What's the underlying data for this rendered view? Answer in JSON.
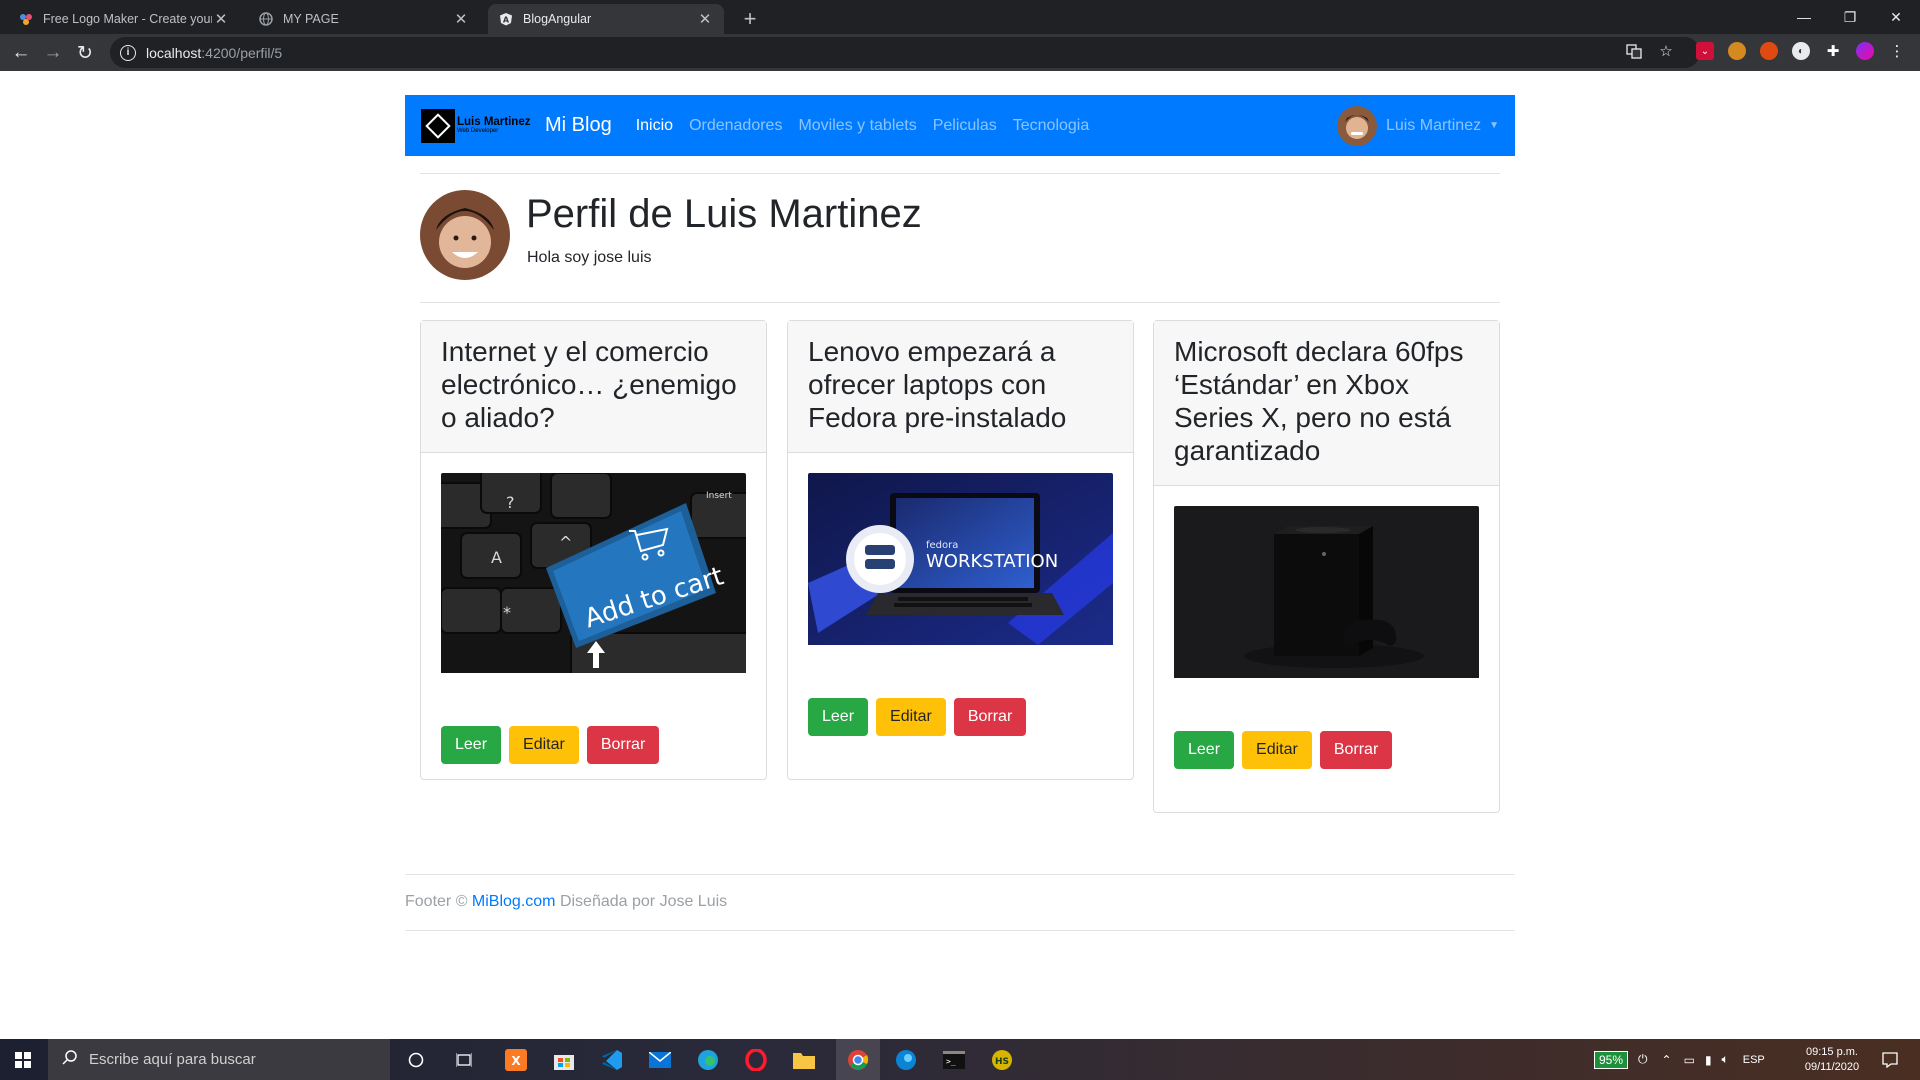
{
  "browser": {
    "tabs": [
      {
        "title": "Free Logo Maker - Create your o",
        "icon": "logo-maker-icon"
      },
      {
        "title": "MY PAGE",
        "icon": "globe-icon"
      },
      {
        "title": "BlogAngular",
        "icon": "angular-icon"
      }
    ],
    "url_host": "localhost",
    "url_path": ":4200/perfil/5"
  },
  "navbar": {
    "logo_name": "Luis Martinez",
    "logo_sub": "Web Developer",
    "brand": "Mi Blog",
    "links": [
      "Inicio",
      "Ordenadores",
      "Moviles y tablets",
      "Peliculas",
      "Tecnologia"
    ],
    "active_link": "Inicio",
    "user_name": "Luis Martinez"
  },
  "profile": {
    "title": "Perfil de Luis Martinez",
    "bio": "Hola soy jose luis"
  },
  "cards": [
    {
      "title": "Internet y el comercio electrónico… ¿enemigo o aliado?",
      "image": "Add to cart",
      "read": "Leer",
      "edit": "Editar",
      "delete": "Borrar"
    },
    {
      "title": "Lenovo empezará a ofrecer laptops con Fedora pre-instalado",
      "image": "WORKSTATION",
      "image_small": "fedora",
      "read": "Leer",
      "edit": "Editar",
      "delete": "Borrar"
    },
    {
      "title": "Microsoft declara 60fps ‘Estándar’ en Xbox Series X, pero no está garantizado",
      "read": "Leer",
      "edit": "Editar",
      "delete": "Borrar"
    }
  ],
  "footer": {
    "prefix": "Footer © ",
    "link": "MiBlog.com",
    "suffix": " Diseñada por Jose Luis"
  },
  "taskbar": {
    "search_placeholder": "Escribe aquí para buscar",
    "battery": "95%",
    "language": "ESP",
    "time": "09:15 p.m.",
    "date": "09/11/2020"
  },
  "colors": {
    "navbar": "#007bff",
    "success": "#28a745",
    "warning": "#ffc107",
    "danger": "#dc3545"
  }
}
